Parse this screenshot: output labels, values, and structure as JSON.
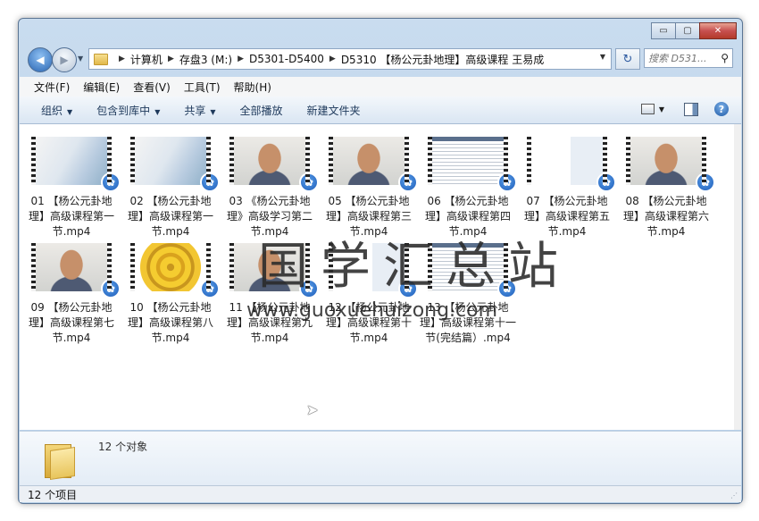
{
  "window": {
    "caption_buttons": [
      "▭",
      "▢",
      "✕"
    ]
  },
  "nav": {
    "back_glyph": "◀",
    "forward_glyph": "▶",
    "breadcrumbs": [
      "计算机",
      "存盘3 (M:)",
      "D5301-D5400",
      "D5310 【杨公元卦地理】高级课程 王易成"
    ],
    "search_placeholder": "搜索 D531...",
    "refresh_glyph": "↻"
  },
  "menu": [
    "文件(F)",
    "编辑(E)",
    "查看(V)",
    "工具(T)",
    "帮助(H)"
  ],
  "toolbar": {
    "organize": "组织",
    "include_in_library": "包含到库中",
    "share": "共享",
    "play_all": "全部播放",
    "new_folder": "新建文件夹",
    "help": "?"
  },
  "files": [
    {
      "name": "01 【杨公元卦地理】高级课程第一节.mp4",
      "thumb": "gray"
    },
    {
      "name": "02 【杨公元卦地理】高级课程第一节.mp4",
      "thumb": "gray"
    },
    {
      "name": "03 《杨公元卦地理》高级学习第二节.mp4",
      "thumb": "man"
    },
    {
      "name": "05 【杨公元卦地理】高级课程第三节.mp4",
      "thumb": "man"
    },
    {
      "name": "06 【杨公元卦地理】高级课程第四节.mp4",
      "thumb": "doc"
    },
    {
      "name": "07 【杨公元卦地理】高级课程第五节.mp4",
      "thumb": "slide"
    },
    {
      "name": "08 【杨公元卦地理】高级课程第六节.mp4",
      "thumb": "man"
    },
    {
      "name": "09 【杨公元卦地理】高级课程第七节.mp4",
      "thumb": "man"
    },
    {
      "name": "10 【杨公元卦地理】高级课程第八节.mp4",
      "thumb": "gold"
    },
    {
      "name": "11 【杨公元卦地理】高级课程第九节.mp4",
      "thumb": "man"
    },
    {
      "name": "12 【杨公元卦地理】高级课程第十节.mp4",
      "thumb": "slide"
    },
    {
      "name": "13 【杨公元卦地理】高级课程第十一节(完结篇）.mp4",
      "thumb": "doc"
    }
  ],
  "watermark": {
    "title": "国学汇总站",
    "url": "www.guoxuehuizong.com"
  },
  "details": {
    "count": "12 个对象"
  },
  "status": {
    "items": "12 个项目"
  }
}
